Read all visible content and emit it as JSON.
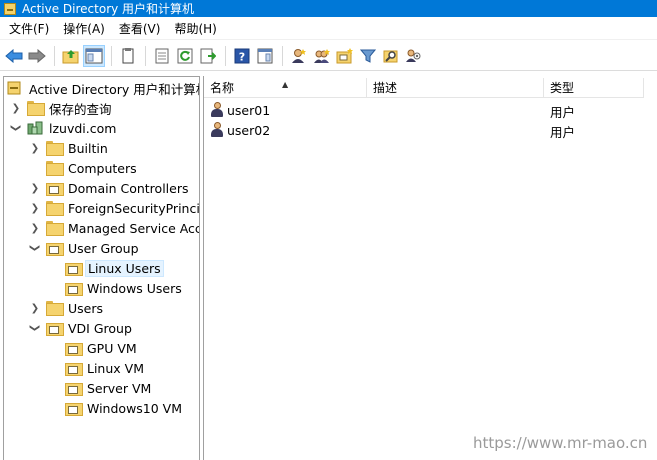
{
  "window": {
    "title": "Active Directory 用户和计算机"
  },
  "menu": [
    "文件(F)",
    "操作(A)",
    "查看(V)",
    "帮助(H)"
  ],
  "toolbar": {
    "buttons": [
      "back-icon",
      "forward-icon",
      "up-folder-icon",
      "show-hide-console-tree-icon",
      "copy-icon",
      "properties-icon",
      "refresh-icon",
      "export-list-icon",
      "help-icon",
      "show-action-pane-icon",
      "new-user-icon",
      "new-group-icon",
      "new-ou-icon",
      "filter-icon",
      "find-icon",
      "add-to-group-icon"
    ]
  },
  "tree": {
    "root": "Active Directory 用户和计算机",
    "saved_queries": "保存的查询",
    "domain": "lzuvdi.com",
    "items": {
      "builtin": "Builtin",
      "computers": "Computers",
      "domain_controllers": "Domain Controllers",
      "foreign_security": "ForeignSecurityPrincipals",
      "managed_service": "Managed Service Accounts",
      "user_group": "User Group",
      "linux_users": "Linux Users",
      "windows_users": "Windows Users",
      "users": "Users",
      "vdi_group": "VDI Group",
      "gpu_vm": "GPU VM",
      "linux_vm": "Linux VM",
      "server_vm": "Server VM",
      "windows10_vm": "Windows10 VM"
    }
  },
  "list": {
    "columns": {
      "name": "名称",
      "desc": "描述",
      "type": "类型"
    },
    "rows": [
      {
        "name": "user01",
        "desc": "",
        "type": "用户"
      },
      {
        "name": "user02",
        "desc": "",
        "type": "用户"
      }
    ]
  },
  "watermark": "https://www.mr-mao.cn",
  "colors": {
    "titlebar": "#0078d7",
    "folder": "#f5d36e",
    "selection": "#e5f3ff"
  }
}
